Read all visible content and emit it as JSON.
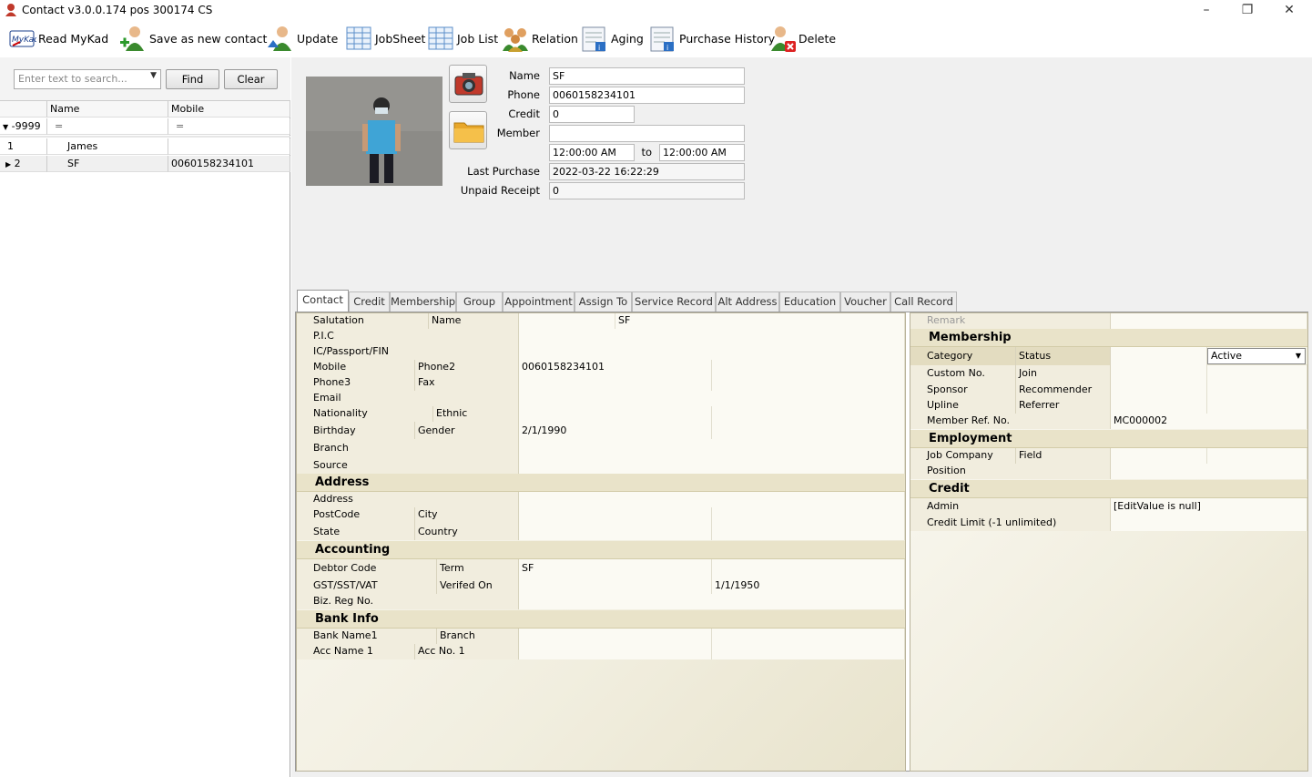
{
  "window": {
    "title": "Contact v3.0.0.174 pos 300174 CS"
  },
  "toolbar": {
    "read_mykad": "Read MyKad",
    "save_new": "Save as new contact",
    "update": "Update",
    "jobsheet": "JobSheet",
    "joblist": "Job List",
    "relation": "Relation",
    "aging": "Aging",
    "purchase_history": "Purchase History",
    "delete": "Delete"
  },
  "search": {
    "placeholder": "Enter text to search...",
    "find": "Find",
    "clear": "Clear"
  },
  "grid": {
    "col_name": "Name",
    "col_mobile": "Mobile",
    "filter_id": "-9999",
    "filter_eq": "=",
    "rows": [
      {
        "id": "1",
        "name": "James",
        "mobile": ""
      },
      {
        "id": "2",
        "name": "SF",
        "mobile": "0060158234101"
      }
    ]
  },
  "header": {
    "name_label": "Name",
    "name_value": "SF",
    "phone_label": "Phone",
    "phone_value": "0060158234101",
    "credit_label": "Credit",
    "credit_value": "0",
    "member_label": "Member",
    "member_value": "",
    "time_from": "12:00:00 AM",
    "to_label": "to",
    "time_to": "12:00:00 AM",
    "last_purchase_label": "Last Purchase",
    "last_purchase_value": "2022-03-22 16:22:29",
    "unpaid_label": "Unpaid Receipt",
    "unpaid_value": "0"
  },
  "tabs": [
    "Contact",
    "Credit",
    "Membership",
    "Group",
    "Appointment",
    "Assign To",
    "Service Record",
    "Alt Address",
    "Education",
    "Voucher",
    "Call Record"
  ],
  "contact": {
    "salutation": "Salutation",
    "name_lbl": "Name",
    "name_val": "SF",
    "pic": "P.I.C",
    "ic": "IC/Passport/FIN",
    "mobile": "Mobile",
    "phone2": "Phone2",
    "mobile_val": "0060158234101",
    "phone3": "Phone3",
    "fax": "Fax",
    "email": "Email",
    "nationality": "Nationality",
    "ethnic": "Ethnic",
    "birthday": "Birthday",
    "gender": "Gender",
    "birthday_val": "2/1/1990",
    "branch": "Branch",
    "source": "Source",
    "cat_address": "Address",
    "address": "Address",
    "postcode": "PostCode",
    "city": "City",
    "state": "State",
    "country": "Country",
    "cat_accounting": "Accounting",
    "debtor": "Debtor Code",
    "term": "Term",
    "debtor_val": "SF",
    "gst": "GST/SST/VAT",
    "verified": "Verifed On",
    "verified_val": "1/1/1950",
    "bizreg": "Biz. Reg No.",
    "cat_bank": "Bank Info",
    "bankname": "Bank Name1",
    "bank_branch": "Branch",
    "accname": "Acc Name 1",
    "accno": "Acc No. 1"
  },
  "side": {
    "remark": "Remark",
    "cat_membership": "Membership",
    "category": "Category",
    "status": "Status",
    "status_val": "Active",
    "customno": "Custom No.",
    "join": "Join",
    "sponsor": "Sponsor",
    "recommender": "Recommender",
    "upline": "Upline",
    "referrer": "Referrer",
    "memberref": "Member Ref. No.",
    "memberref_val": "MC000002",
    "cat_employment": "Employment",
    "jobcompany": "Job Company",
    "field": "Field",
    "position": "Position",
    "cat_credit": "Credit",
    "admin": "Admin",
    "admin_val": "[EditValue is null]",
    "creditlimit": "Credit Limit (-1 unlimited)"
  }
}
